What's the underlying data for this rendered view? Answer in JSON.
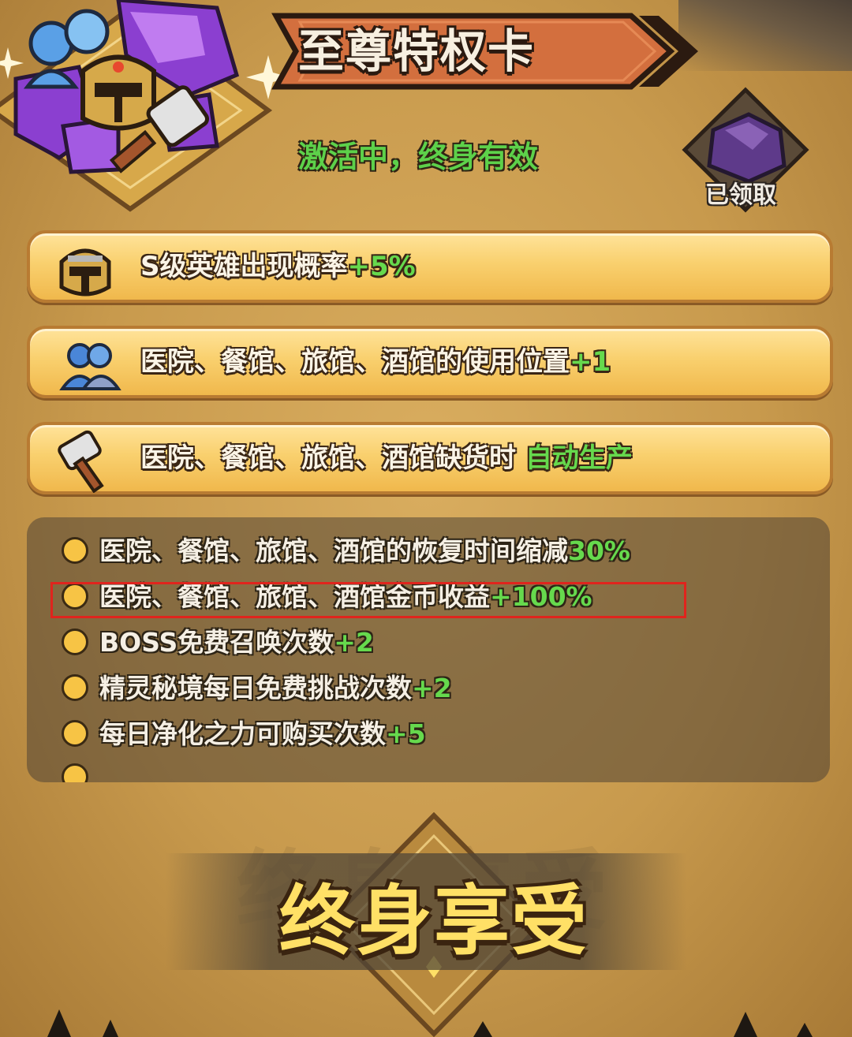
{
  "header": {
    "title": "至尊特权卡",
    "status": "激活中，终身有效",
    "claimed_label": "已领取"
  },
  "perks": [
    {
      "icon": "helmet-icon",
      "text": "S级英雄出现概率",
      "bonus": "+5%"
    },
    {
      "icon": "people-icon",
      "text": "医院、餐馆、旅馆、酒馆的使用位置",
      "bonus": "+1"
    },
    {
      "icon": "hammer-icon",
      "text": "医院、餐馆、旅馆、酒馆缺货时",
      "bonus": "自动生产"
    }
  ],
  "benefits": [
    {
      "text": "医院、餐馆、旅馆、酒馆的恢复时间缩减",
      "bonus": "30%"
    },
    {
      "text": "医院、餐馆、旅馆、酒馆金币收益",
      "bonus": "+100%",
      "highlighted": true
    },
    {
      "text": "BOSS免费召唤次数",
      "bonus": "+2"
    },
    {
      "text": "精灵秘境每日免费挑战次数",
      "bonus": "+2"
    },
    {
      "text": "每日净化之力可购买次数",
      "bonus": "+5"
    }
  ],
  "banner": {
    "text": "终身享受"
  },
  "colors": {
    "accent_green": "#66d94d",
    "highlight_red": "#e0241d",
    "banner_yellow": "#ffe066"
  }
}
